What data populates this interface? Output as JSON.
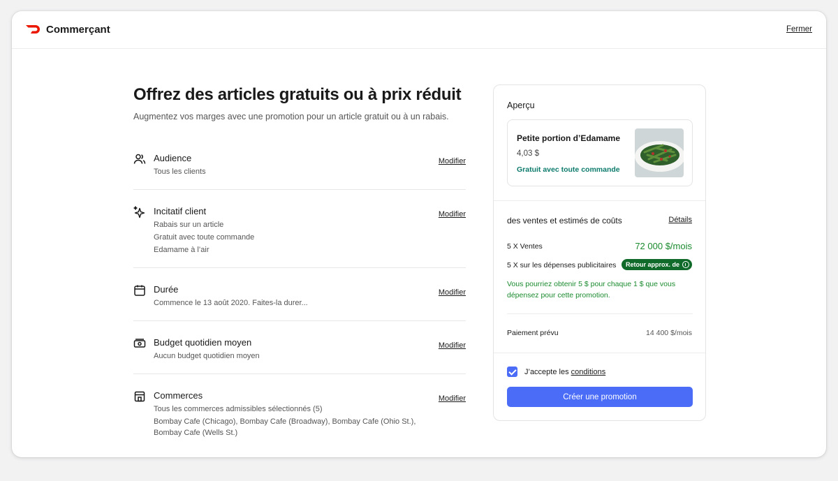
{
  "header": {
    "brand": "Commerçant",
    "close_label": "Fermer",
    "accent": "#eb1700"
  },
  "main": {
    "title": "Offrez des articles gratuits ou à prix réduit",
    "subtitle": "Augmentez vos marges avec une promotion pour un article gratuit ou à un rabais.",
    "edit_label": "Modifier",
    "sections": [
      {
        "icon": "audience-icon",
        "title": "Audience",
        "lines": [
          "Tous les clients"
        ]
      },
      {
        "icon": "sparkle-icon",
        "title": "Incitatif client",
        "lines": [
          "Rabais sur un article",
          "Gratuit avec toute commande",
          "Edamame à l’air"
        ]
      },
      {
        "icon": "calendar-icon",
        "title": "Durée",
        "lines": [
          "Commence le 13 août 2020. Faites-la durer..."
        ]
      },
      {
        "icon": "money-icon",
        "title": "Budget quotidien moyen",
        "lines": [
          "Aucun budget quotidien moyen"
        ]
      },
      {
        "icon": "store-icon",
        "title": "Commerces",
        "lines": [
          "Tous les commerces admissibles sélectionnés (5)",
          "Bombay Cafe (Chicago), Bombay Cafe (Broadway), Bombay Cafe (Ohio St.),",
          "Bombay Cafe (Wells St.)"
        ]
      }
    ]
  },
  "preview": {
    "label": "Aperçu",
    "item_name": "Petite portion d’Edamame",
    "item_price": "4,03 $",
    "offer": "Gratuit avec toute commande"
  },
  "stats": {
    "title": "des ventes et estimés de coûts",
    "details_label": "Détails",
    "sales_label": "5 X Ventes",
    "sales_value": "72 000 $/mois",
    "ads_label": "5 X sur les dépenses publicitaires",
    "roi_badge": "Retour approx. de",
    "roi_note": "Vous pourriez obtenir 5 $ pour chaque 1 $ que vous dépensez pour cette promotion.",
    "payment_label": "Paiement prévu",
    "payment_value": "14 400 $/mois",
    "green": "#1a8a2e"
  },
  "footer": {
    "accept_prefix": "J’accepte les",
    "accept_link": "conditions",
    "accept_checked": true,
    "create_label": "Créer une promotion",
    "button_color": "#4a6cf7"
  }
}
